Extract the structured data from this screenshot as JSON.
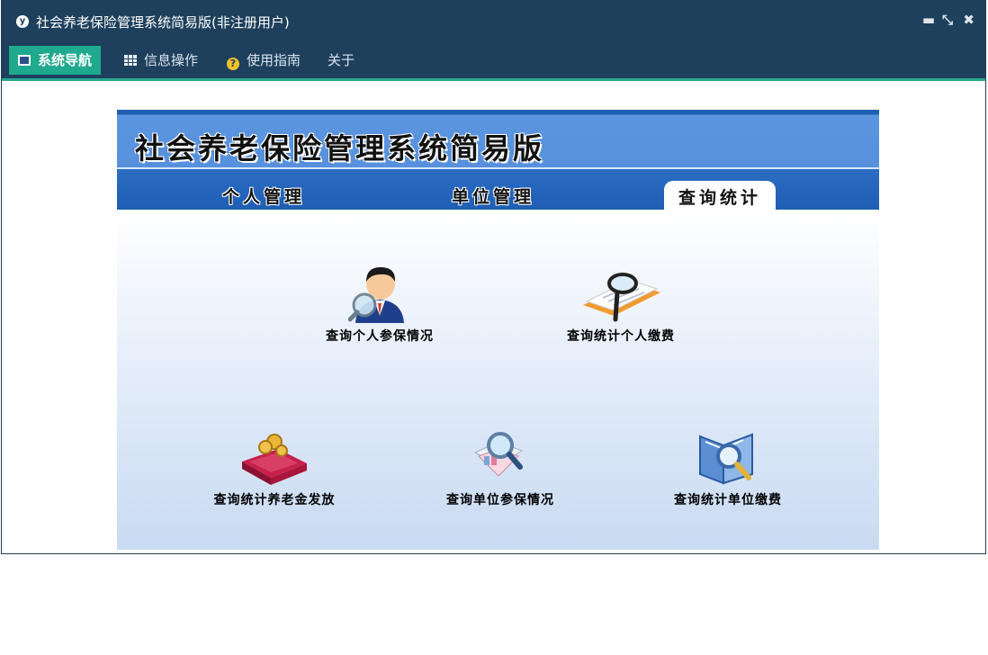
{
  "window": {
    "title": "社会养老保险管理系统简易版(非注册用户)",
    "controls": {
      "minimize": "▬",
      "restore": "⤡",
      "close": "✖"
    }
  },
  "menu": {
    "items": [
      {
        "label": "系统导航",
        "icon": "monitor-icon",
        "active": true
      },
      {
        "label": "信息操作",
        "icon": "grid-icon"
      },
      {
        "label": "使用指南",
        "icon": "help-icon"
      },
      {
        "label": "关于"
      }
    ]
  },
  "app": {
    "banner_title": "社会养老保险管理系统简易版",
    "tabs": [
      {
        "label": "个人管理"
      },
      {
        "label": "单位管理"
      },
      {
        "label": "查询统计",
        "selected": true
      }
    ],
    "tiles": [
      {
        "label": "查询个人参保情况",
        "icon": "person-search-icon"
      },
      {
        "label": "查询统计个人缴费",
        "icon": "document-magnifier-icon"
      },
      {
        "label": "查询统计养老金发放",
        "icon": "money-book-icon"
      },
      {
        "label": "查询单位参保情况",
        "icon": "report-search-icon"
      },
      {
        "label": "查询统计单位缴费",
        "icon": "book-search-icon"
      }
    ]
  },
  "colors": {
    "titlebar": "#1e405c",
    "menu_active": "#1fa98d",
    "accent_line": "#26a88f",
    "banner": "#5790dc",
    "tabstrip": "#1e5eb4"
  }
}
